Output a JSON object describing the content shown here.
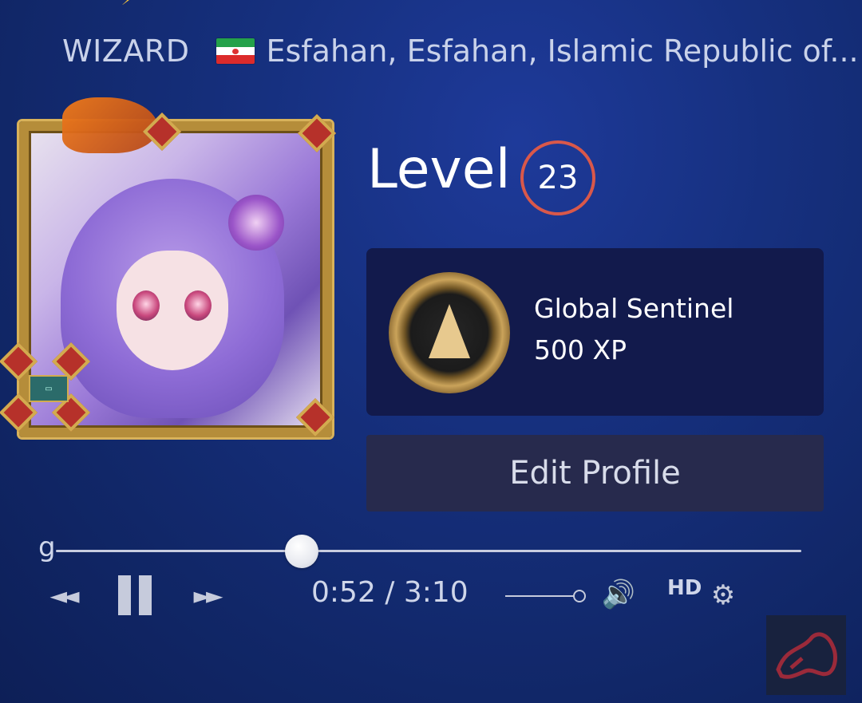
{
  "profile": {
    "username": "WIZARD",
    "location": "Esfahan, Esfahan, Islamic Republic of...",
    "flag_icon": "iran-flag-icon",
    "level_label": "Level",
    "level_value": "23",
    "badge": {
      "title": "Global Sentinel",
      "xp": "500 XP",
      "icon": "global-sentinel-badge-icon"
    },
    "edit_button_label": "Edit Profile"
  },
  "player": {
    "leading_char": "g",
    "rewind_icon": "◄◄",
    "forward_icon": "►►",
    "time_display": "0:52 / 3:10",
    "progress_fraction": 0.33,
    "volume_icon": "🔊",
    "hd_label": "HD",
    "settings_icon": "⚙"
  },
  "colors": {
    "level_ring": "#d9584a",
    "badge_card_bg": "#121a4c",
    "edit_button_bg": "#272a4d"
  }
}
